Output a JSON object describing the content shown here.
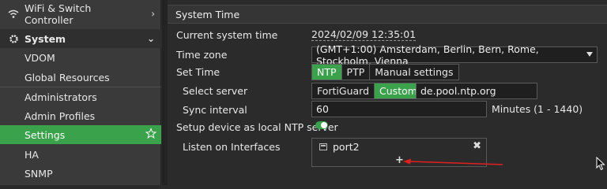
{
  "sidebar": {
    "wifi_label": "WiFi & Switch\nController",
    "system_label": "System",
    "items": [
      {
        "label": "VDOM"
      },
      {
        "label": "Global Resources"
      },
      {
        "label": "Administrators"
      },
      {
        "label": "Admin Profiles"
      },
      {
        "label": "Settings"
      },
      {
        "label": "HA"
      },
      {
        "label": "SNMP"
      }
    ]
  },
  "section_title": "System Time",
  "current_time": {
    "label": "Current system time",
    "value": "2024/02/09 12:35:01"
  },
  "time_zone": {
    "label": "Time zone",
    "value": "(GMT+1:00) Amsterdam, Berlin, Bern, Rome, Stockholm, Vienna"
  },
  "set_time": {
    "label": "Set Time",
    "options": [
      "NTP",
      "PTP",
      "Manual settings"
    ],
    "selected": "NTP"
  },
  "select_server": {
    "label": "Select server",
    "options": [
      "FortiGuard",
      "Custom"
    ],
    "selected": "Custom",
    "server_value": "de.pool.ntp.org"
  },
  "sync_interval": {
    "label": "Sync interval",
    "value": "60",
    "hint": "Minutes (1 - 1440)"
  },
  "local_ntp": {
    "label": "Setup device as local NTP server",
    "enabled": true
  },
  "listen_interfaces": {
    "label": "Listen on Interfaces",
    "interfaces": [
      "port2"
    ],
    "add_symbol": "+",
    "remove_symbol": "✖"
  },
  "colors": {
    "accent": "#39a24a",
    "arrow": "#e02020"
  }
}
